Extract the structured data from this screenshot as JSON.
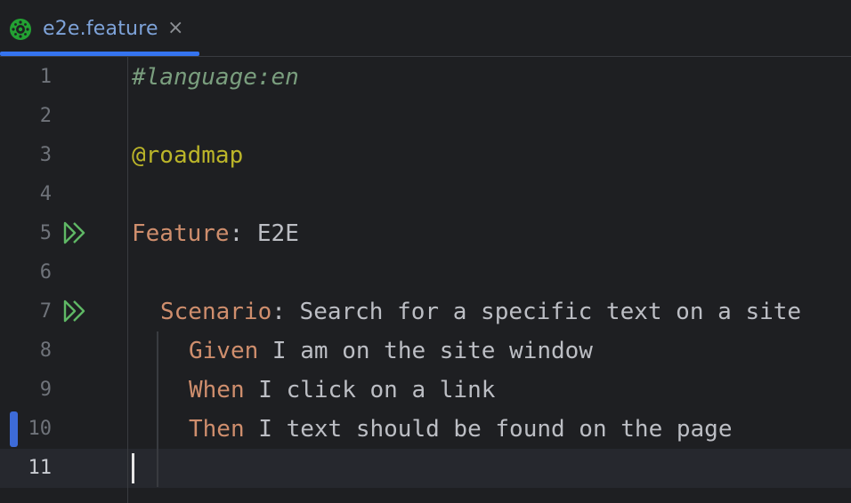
{
  "tab": {
    "label": "e2e.feature",
    "close": "×",
    "icon": "cucumber-icon"
  },
  "colors": {
    "background": "#1e1f22",
    "keyword": "#cf8e6d",
    "tag": "#bbb529",
    "comment": "#7a9e7e",
    "text": "#bcbec4",
    "accent": "#3574f0",
    "run": "#5fb865"
  },
  "lines": [
    {
      "number": "1",
      "parts": [
        {
          "text": "#language:en",
          "style": "comment"
        }
      ]
    },
    {
      "number": "2",
      "parts": []
    },
    {
      "number": "3",
      "parts": [
        {
          "text": "@roadmap",
          "style": "tag"
        }
      ]
    },
    {
      "number": "4",
      "parts": []
    },
    {
      "number": "5",
      "run": true,
      "parts": [
        {
          "text": "Feature",
          "style": "kw"
        },
        {
          "text": ": E2E",
          "style": "plain"
        }
      ]
    },
    {
      "number": "6",
      "parts": []
    },
    {
      "number": "7",
      "run": true,
      "indent": 1,
      "parts": [
        {
          "text": "Scenario",
          "style": "kw"
        },
        {
          "text": ": Search for a specific text on a site",
          "style": "plain"
        }
      ]
    },
    {
      "number": "8",
      "indent": 2,
      "parts": [
        {
          "text": "Given",
          "style": "kw"
        },
        {
          "text": " I am on the site window",
          "style": "plain"
        }
      ]
    },
    {
      "number": "9",
      "indent": 2,
      "parts": [
        {
          "text": "When",
          "style": "kw"
        },
        {
          "text": " I click on a link",
          "style": "plain"
        }
      ]
    },
    {
      "number": "10",
      "indent": 2,
      "modified": true,
      "parts": [
        {
          "text": "Then",
          "style": "kw"
        },
        {
          "text": " I text should be found on the page",
          "style": "plain"
        }
      ]
    },
    {
      "number": "11",
      "current": true,
      "parts": []
    }
  ]
}
